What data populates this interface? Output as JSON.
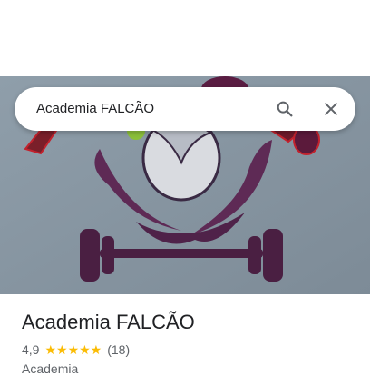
{
  "search": {
    "value": "Academia FALCÃO",
    "search_icon": "search-icon",
    "close_icon": "close-icon"
  },
  "photo": {
    "description_icon": "gym-logo-photo"
  },
  "place": {
    "title": "Academia FALCÃO",
    "rating": "4,9",
    "stars": "★★★★★",
    "review_count": "(18)",
    "category": "Academia"
  },
  "colors": {
    "star": "#fbbc04",
    "text_primary": "#202124",
    "text_secondary": "#5f6368"
  }
}
